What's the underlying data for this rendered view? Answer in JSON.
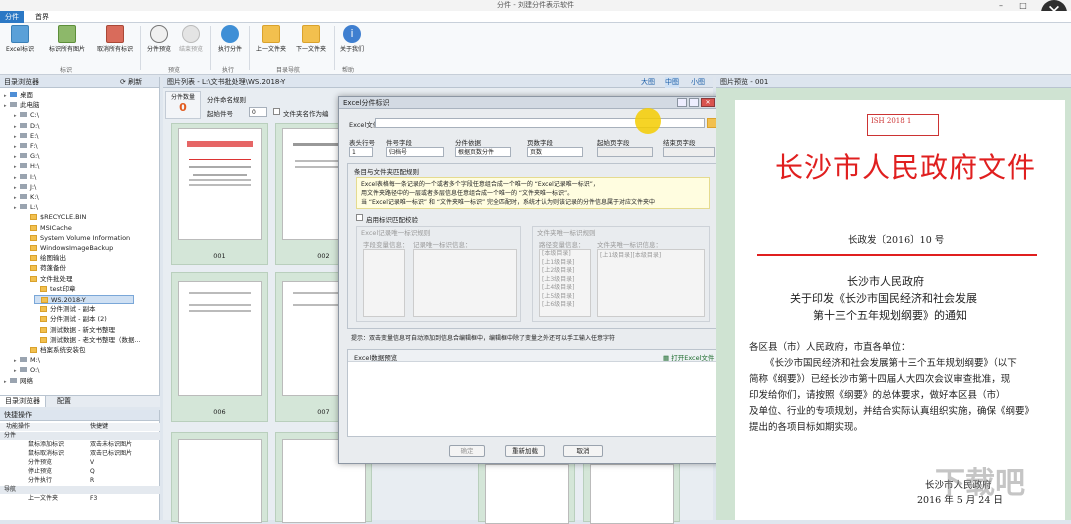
{
  "window": {
    "title": "分件 - 刘建分件表示软件"
  },
  "tabs": [
    "分件",
    "首界"
  ],
  "ribbon": {
    "buttons": [
      "Excel标识",
      "标识所有图片",
      "取消所有标识",
      "分件预览",
      "结束预览",
      "执行分件",
      "上一文件夹",
      "下一文件夹",
      "关于我们"
    ],
    "groups": [
      "标识",
      "预览",
      "执行",
      "目录导航",
      "帮助"
    ]
  },
  "left": {
    "tree_title": "目录浏览器",
    "refresh": "刷新",
    "tree": [
      {
        "label": "桌面",
        "level": 0,
        "icon": "desktop"
      },
      {
        "label": "此电脑",
        "level": 0,
        "icon": "pc"
      },
      {
        "label": "C:\\",
        "level": 1,
        "icon": "drive"
      },
      {
        "label": "D:\\",
        "level": 1,
        "icon": "drive"
      },
      {
        "label": "E:\\",
        "level": 1,
        "icon": "drive"
      },
      {
        "label": "F:\\",
        "level": 1,
        "icon": "drive"
      },
      {
        "label": "G:\\",
        "level": 1,
        "icon": "drive"
      },
      {
        "label": "H:\\",
        "level": 1,
        "icon": "drive"
      },
      {
        "label": "I:\\",
        "level": 1,
        "icon": "drive"
      },
      {
        "label": "J:\\",
        "level": 1,
        "icon": "drive"
      },
      {
        "label": "K:\\",
        "level": 1,
        "icon": "drive"
      },
      {
        "label": "L:\\",
        "level": 1,
        "icon": "drive"
      },
      {
        "label": "$RECYCLE.BIN",
        "level": 2,
        "icon": "folder"
      },
      {
        "label": "MSICache",
        "level": 2,
        "icon": "folder"
      },
      {
        "label": "System Volume Information",
        "level": 2,
        "icon": "folder"
      },
      {
        "label": "WindowsImageBackup",
        "level": 2,
        "icon": "folder"
      },
      {
        "label": "绘图输出",
        "level": 2,
        "icon": "folder"
      },
      {
        "label": "荷蓬备份",
        "level": 2,
        "icon": "folder"
      },
      {
        "label": "文件批处理",
        "level": 2,
        "icon": "folder"
      },
      {
        "label": "test印章",
        "level": 3,
        "icon": "folder"
      },
      {
        "label": "WS.2018-Y",
        "level": 3,
        "icon": "folder"
      },
      {
        "label": "分件测试 - 副本",
        "level": 3,
        "icon": "folder"
      },
      {
        "label": "分件测试 - 副本 (2)",
        "level": 3,
        "icon": "folder"
      },
      {
        "label": "测试数据 - 新文书整理",
        "level": 3,
        "icon": "folder"
      },
      {
        "label": "测试数据 - 老文书整理（数据...",
        "level": 3,
        "icon": "folder"
      },
      {
        "label": "档案系统安装包",
        "level": 2,
        "icon": "folder"
      },
      {
        "label": "M:\\",
        "level": 1,
        "icon": "drive"
      },
      {
        "label": "O:\\",
        "level": 1,
        "icon": "drive"
      },
      {
        "label": "网络",
        "level": 0,
        "icon": "net"
      }
    ],
    "bottom_tabs": [
      "目录浏览器",
      "配置"
    ],
    "shortcut_title": "快捷操作",
    "shortcut_cols": [
      "功能操作",
      "快捷键"
    ],
    "shortcuts": [
      {
        "name": "分件",
        "key": "",
        "group": true
      },
      {
        "name": "鼠标添加标识",
        "key": "双击未标识图片"
      },
      {
        "name": "鼠标取消标识",
        "key": "双击已标识图片"
      },
      {
        "name": "分件预览",
        "key": "V"
      },
      {
        "name": "停止预览",
        "key": "Q"
      },
      {
        "name": "分件执行",
        "key": "R"
      },
      {
        "name": "导航",
        "key": "",
        "group": true
      },
      {
        "name": "上一文件夹",
        "key": "F3"
      }
    ]
  },
  "center": {
    "path": "图片列表 - L:\\文书批处理\\WS.2018-Y",
    "count_label": "分件数量",
    "count_value": "0",
    "naming_label": "分件命名规则",
    "start_label": "起始件号",
    "start_value": "0",
    "checkbox_label": "文件夹名作为编",
    "size_options": [
      "大图",
      "中图",
      "小图"
    ],
    "thumbs": [
      "001",
      "002",
      "006",
      "007"
    ]
  },
  "dialog": {
    "title": "Excel分件标识",
    "excel_file_label": "Excel文件",
    "header_row_label": "表头行号",
    "header_row_value": "1",
    "piece_field_label": "件号字段",
    "piece_field_value": "归档号",
    "basis_label": "分件依据",
    "basis_value": "根据页数分件",
    "pages_field_label": "页数字段",
    "pages_field_value": "页数",
    "start_page_label": "起始页字段",
    "end_page_label": "结束页字段",
    "rule_group": "条目与文件夹匹配规则",
    "info_lines": [
      "Excel表格每一条记录的一个或者多个字段任意组合成一个唯一的 “Excel记录唯一标识”，",
      "用文件夹路径中的一层或者多层信息任意组合成一个唯一的 “文件夹唯一标识”。",
      "当 “Excel记录唯一标识” 和 “文件夹唯一标识” 完全匹配时，系统才认为则该记录的分件信息属于对应文件夹中"
    ],
    "enable_label": "启用标识匹配校验",
    "excel_rule_title": "Excel记录唯一标识规则",
    "field_info_label": "字段变量信息：",
    "record_id_label": "记录唯一标识信息：",
    "folder_rule_title": "文件夹唯一标识规则",
    "path_info_label": "路径变量信息：",
    "folder_id_label": "文件夹唯一标识信息：",
    "path_vars": [
      "[本级目录]",
      "[上1级目录]",
      "[上2级目录]",
      "[上3级目录]",
      "[上4级目录]",
      "[上5级目录]",
      "[上6级目录]"
    ],
    "folder_id_value": "[上1级目录][本级目录]",
    "tip": "提示：双击变量信息可自动添加到信息合编辑框中，编辑框中除了变量之外还可以手工输入任意字符",
    "preview_label": "Excel数据预览",
    "open_excel": "打开Excel文件",
    "ok": "确定",
    "reload": "重新加载",
    "cancel": "取消"
  },
  "preview": {
    "title": "图片预览 - 001",
    "stamp": "ISH 2018 1",
    "heading": "长沙市人民政府文件",
    "docnum": "长政发〔2016〕10 号",
    "sub1": "长沙市人民政府",
    "sub2": "关于印发《长沙市国民经济和社会发展",
    "sub3": "第十三个五年规划纲要》的通知",
    "addressee": "各区县（市）人民政府，市直各单位：",
    "body": [
      "《长沙市国民经济和社会发展第十三个五年规划纲要》（以下",
      "简称《纲要》）已经长沙市第十四届人大四次会议审查批准，现",
      "印发给你们，请按照《纲要》的总体要求，做好本区县（市）",
      "及单位、行业的专项规划，并结合实际认真组织实施，确保《纲要》",
      "提出的各项目标如期实现。"
    ],
    "signer": "长沙市人民政府",
    "date": "2016 年 5 月 24 日"
  },
  "watermark": "下载吧"
}
